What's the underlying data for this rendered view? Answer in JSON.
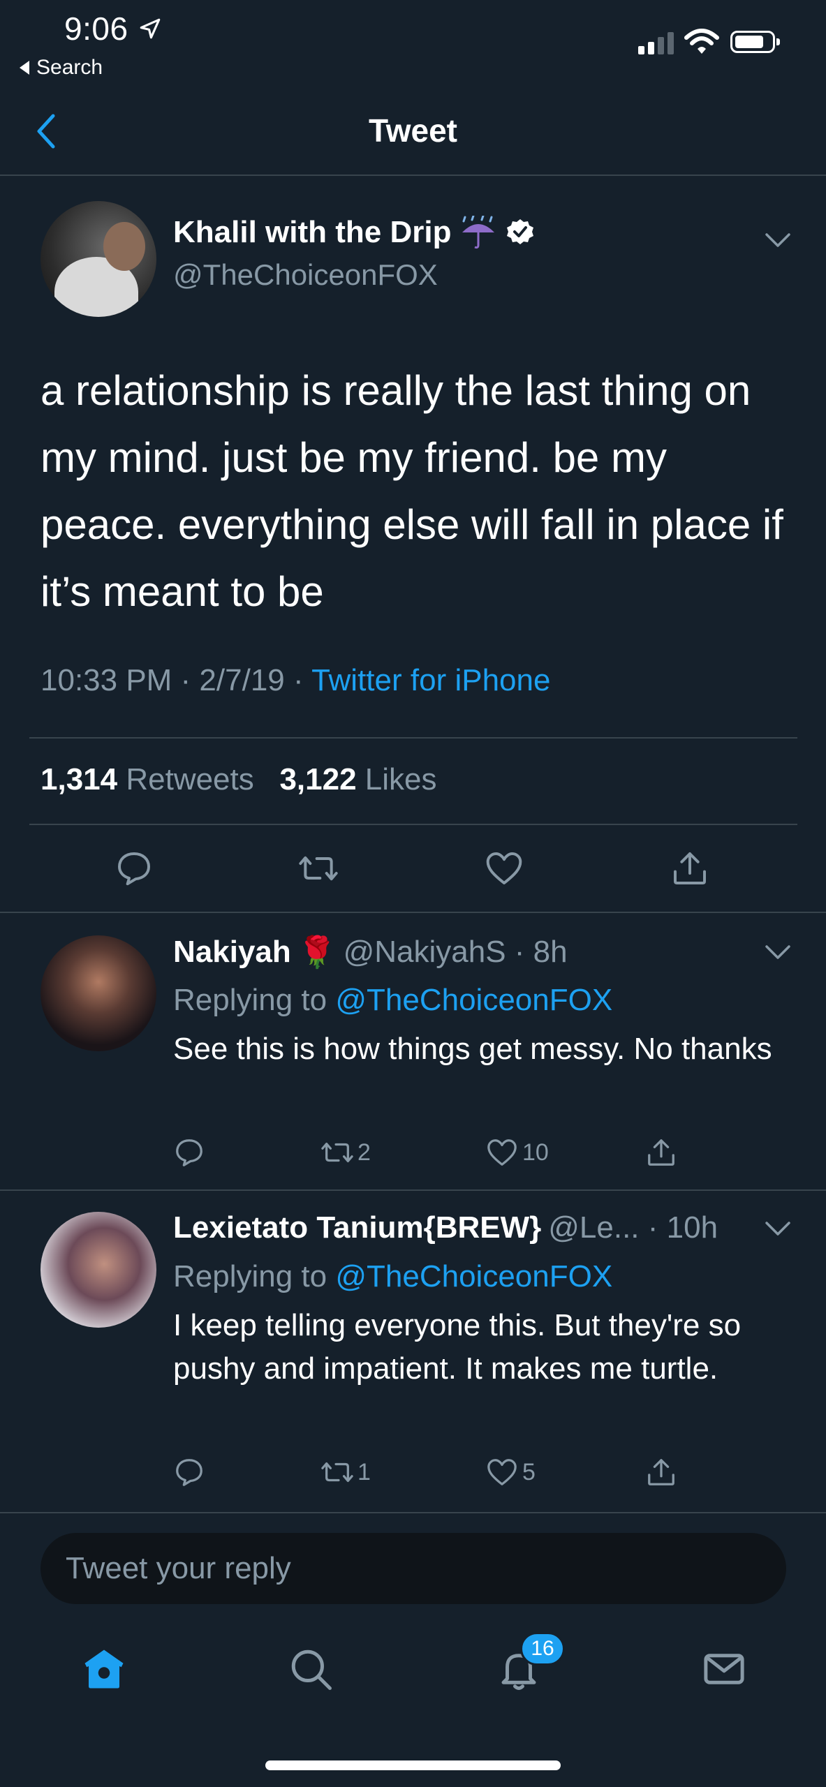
{
  "status_bar": {
    "time": "9:06",
    "back_label": "Search"
  },
  "header": {
    "title": "Tweet"
  },
  "main_tweet": {
    "display_name": "Khalil with the Drip",
    "handle": "@TheChoiceonFOX",
    "text": "a relationship is really the last thing on my mind. just be my friend. be my peace. everything else will fall in place if it’s meant to be",
    "timestamp": "10:33 PM · 2/7/19 · ",
    "source": "Twitter for iPhone",
    "retweets_count": "1,314",
    "retweets_label": "Retweets",
    "likes_count": "3,122",
    "likes_label": "Likes"
  },
  "replies": [
    {
      "display_name": "Nakiyah",
      "emoji": "🌹",
      "handle": "@NakiyahS · 8h",
      "replying_prefix": "Replying to ",
      "replying_to": "@TheChoiceonFOX",
      "text": "See this is how things get messy. No thanks",
      "reply_count": "",
      "retweet_count": "2",
      "like_count": "10"
    },
    {
      "display_name": "Lexietato Tanium{BREW}",
      "handle": "@Le... · 10h",
      "replying_prefix": "Replying to ",
      "replying_to": "@TheChoiceonFOX",
      "text": "I keep telling everyone this. But they're so pushy and impatient. It makes me turtle.",
      "reply_count": "",
      "retweet_count": "1",
      "like_count": "5"
    }
  ],
  "reply_box": {
    "placeholder": "Tweet your reply"
  },
  "tab_bar": {
    "notifications_badge": "16"
  },
  "colors": {
    "background": "#15202b",
    "accent": "#1da1f2",
    "secondary_text": "#8899a6",
    "divider": "#38444d"
  }
}
